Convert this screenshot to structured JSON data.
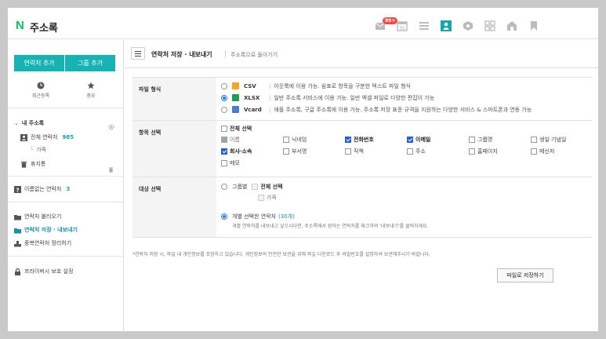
{
  "header": {
    "logo": "N",
    "title": "주소록",
    "badge": "99+",
    "calendar_day": "31",
    "icons": [
      "mail-icon",
      "calendar-icon",
      "list-icon",
      "contacts-icon",
      "cube-icon",
      "memo-icon",
      "home-icon",
      "bookmark-icon"
    ]
  },
  "sidebar": {
    "add_contact": "연락처 추가",
    "add_group": "그룹 추가",
    "recent": "최근등록",
    "important": "중요",
    "my_addressbook": "내 주소록",
    "all_contacts": "전체 연락처",
    "all_count": "985",
    "family": "가족",
    "trash": "휴지통",
    "no_name": "이름없는 연락처",
    "no_name_count": "3",
    "import": "연락처 불러오기",
    "export": "연락처 저장 · 내보내기",
    "dedupe": "중복연락처 정리하기",
    "privacy": "프라이버시 보호 설정"
  },
  "main": {
    "title": "연락처 저장 · 내보내기",
    "back_link": "주소록으로 돌아가기",
    "format_label": "파일 형식",
    "formats": [
      {
        "name": "CSV",
        "desc": "아웃룩에 이용 가능. 쉼표로 항목을 구분한 텍스트 파일 형식",
        "selected": false,
        "color": "#f5a623"
      },
      {
        "name": "XLSX",
        "desc": "일반 주소록 서비스에 이용 가능. 일반 엑셀 파일로 다양한 편집이 가능",
        "selected": true,
        "color": "#1f9d55"
      },
      {
        "name": "Vcard",
        "desc": "애플 주소록, 구글 주소록에 이용 가능. 주소록 저장 표준 규격을 지원하는 다양한 서비스 & 스마트폰과 연동 가능",
        "selected": false,
        "color": "#4a7bd0"
      }
    ],
    "fields_label": "항목 선택",
    "select_all": "전체 선택",
    "fields": [
      {
        "label": "이름",
        "checked": true,
        "disabled": true
      },
      {
        "label": "닉네임",
        "checked": false,
        "disabled": false
      },
      {
        "label": "전화번호",
        "checked": true,
        "disabled": false
      },
      {
        "label": "이메일",
        "checked": true,
        "disabled": false
      },
      {
        "label": "그룹명",
        "checked": false,
        "disabled": false
      },
      {
        "label": "생일·기념일",
        "checked": false,
        "disabled": false
      },
      {
        "label": "회사·소속",
        "checked": true,
        "disabled": false
      },
      {
        "label": "부서명",
        "checked": false,
        "disabled": false
      },
      {
        "label": "직책",
        "checked": false,
        "disabled": false
      },
      {
        "label": "주소",
        "checked": false,
        "disabled": false
      },
      {
        "label": "홈페이지",
        "checked": false,
        "disabled": false
      },
      {
        "label": "메신저",
        "checked": false,
        "disabled": false
      },
      {
        "label": "메모",
        "checked": false,
        "disabled": false
      }
    ],
    "target_label": "대상 선택",
    "by_group": "그룹별",
    "group_select_all": "전체 선택",
    "group_family": "가족",
    "individual": "개별 선택한 연락처",
    "individual_count": "(30개)",
    "individual_hint": "개별 연락처를 내보내고 싶으시다면, 주소록에서 원하는 연락처를 체크하여 '내보내기'를 클릭하세요.",
    "footnote": "*연락처 저장 시, 파일 내 개인정보를 포함하고 있습니다. 개인정보의 안전한 보관을 위해 파일 다운로드 후 비밀번호를 설정하여 보관해주시기 바랍니다.",
    "save_button": "파일로 저장하기"
  }
}
